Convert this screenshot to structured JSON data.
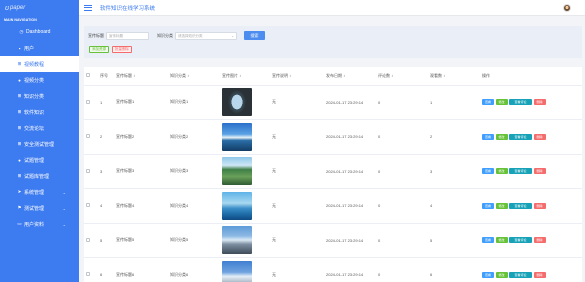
{
  "brand": {
    "logo_text": "paper"
  },
  "sidebar": {
    "section_title": "MAIN NAVIGATION",
    "items": [
      {
        "label": "Dashboard",
        "icon": "dashboard-icon",
        "glyph": "◷",
        "active": false,
        "chevron": false
      },
      {
        "label": "用户",
        "icon": "user-icon",
        "glyph": "▪",
        "active": false,
        "chevron": false
      },
      {
        "label": "视频教程",
        "icon": "grid-icon",
        "glyph": "⊞",
        "active": true,
        "chevron": false
      },
      {
        "label": "视频分类",
        "icon": "chat-icon",
        "glyph": "●",
        "active": false,
        "chevron": false
      },
      {
        "label": "知识分类",
        "icon": "grid-icon",
        "glyph": "⊞",
        "active": false,
        "chevron": false
      },
      {
        "label": "软件知识",
        "icon": "grid-icon",
        "glyph": "⊞",
        "active": false,
        "chevron": false
      },
      {
        "label": "交流论坛",
        "icon": "grid-icon",
        "glyph": "⊞",
        "active": false,
        "chevron": false
      },
      {
        "label": "安全测试管理",
        "icon": "grid-icon",
        "glyph": "⊞",
        "active": false,
        "chevron": false
      },
      {
        "label": "试题管理",
        "icon": "chat-icon",
        "glyph": "●",
        "active": false,
        "chevron": false
      },
      {
        "label": "试题库管理",
        "icon": "grid-icon",
        "glyph": "⊞",
        "active": false,
        "chevron": false
      },
      {
        "label": "系统管理",
        "icon": "send-icon",
        "glyph": "➤",
        "active": false,
        "chevron": true
      },
      {
        "label": "测试管理",
        "icon": "flag-icon",
        "glyph": "⚑",
        "active": false,
        "chevron": true
      },
      {
        "label": "用户资料",
        "icon": "card-icon",
        "glyph": "▭",
        "active": false,
        "chevron": true
      }
    ]
  },
  "header": {
    "title": "软件知识在线学习系统"
  },
  "search": {
    "name_label": "宣传标题",
    "name_placeholder": "宣传标题",
    "category_label": "知识分类",
    "category_placeholder": "请选择知识分类",
    "search_button": "搜索"
  },
  "actions": {
    "add_label": "添加资源",
    "delete_label": "批量删除"
  },
  "table": {
    "headers": {
      "index": "序号",
      "title": "宣传标题",
      "category": "知识分类",
      "image": "宣传图片",
      "desc": "宣传说明",
      "date": "发布日期",
      "comments": "评论数",
      "clicks": "观看数",
      "ops": "操作"
    },
    "sort_glyph": "⇕",
    "op_labels": {
      "view": "查看",
      "edit": "修改",
      "comment": "查看评论",
      "delete": "删除"
    },
    "rows": [
      {
        "index": "1",
        "title": "宣传标题1",
        "category": "知识分类1",
        "thumb": "t1",
        "desc": "无",
        "date": "2024-01-17 23:29:14",
        "comments": "0",
        "clicks": "1"
      },
      {
        "index": "2",
        "title": "宣传标题2",
        "category": "知识分类2",
        "thumb": "t2",
        "desc": "无",
        "date": "2024-01-17 23:29:14",
        "comments": "0",
        "clicks": "2"
      },
      {
        "index": "3",
        "title": "宣传标题3",
        "category": "知识分类3",
        "thumb": "t3",
        "desc": "无",
        "date": "2024-01-17 23:29:14",
        "comments": "0",
        "clicks": "3"
      },
      {
        "index": "4",
        "title": "宣传标题4",
        "category": "知识分类4",
        "thumb": "t4",
        "desc": "无",
        "date": "2024-01-17 23:29:14",
        "comments": "0",
        "clicks": "4"
      },
      {
        "index": "5",
        "title": "宣传标题5",
        "category": "知识分类5",
        "thumb": "t5",
        "desc": "无",
        "date": "2024-01-17 23:29:14",
        "comments": "0",
        "clicks": "5"
      },
      {
        "index": "6",
        "title": "宣传标题6",
        "category": "知识分类6",
        "thumb": "t6",
        "desc": "无",
        "date": "2024-01-17 23:29:14",
        "comments": "0",
        "clicks": "6"
      }
    ]
  },
  "colors": {
    "primary": "#3d7bf0",
    "success": "#67c23a",
    "danger": "#f56c6c",
    "info": "#17a2b8"
  }
}
